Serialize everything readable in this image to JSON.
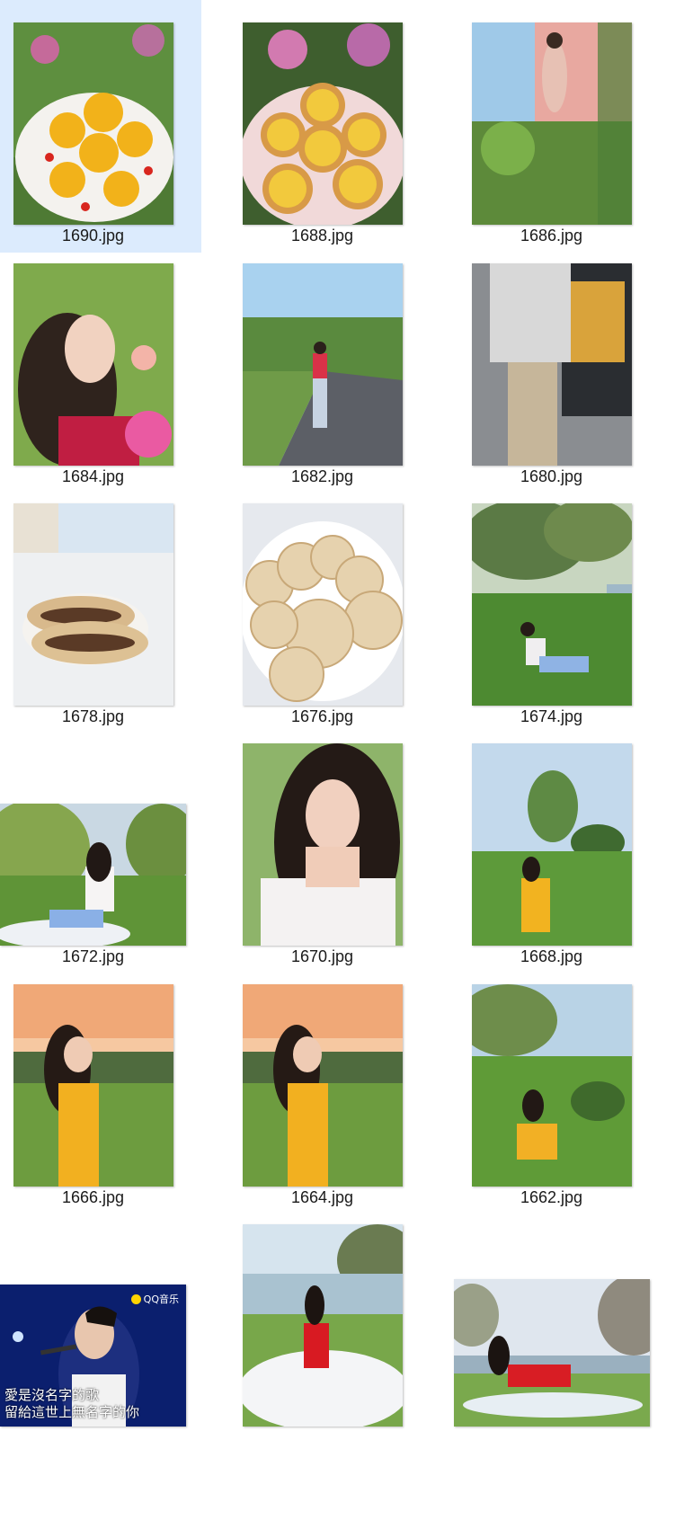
{
  "files": [
    {
      "name": "1690.jpg",
      "selected": true,
      "icon": "fruit-plate-photo"
    },
    {
      "name": "1688.jpg",
      "selected": false,
      "icon": "egg-tarts-photo"
    },
    {
      "name": "1686.jpg",
      "selected": false,
      "icon": "balcony-garden-photo"
    },
    {
      "name": "1684.jpg",
      "selected": false,
      "icon": "portrait-flowers-photo"
    },
    {
      "name": "1682.jpg",
      "selected": false,
      "icon": "road-pose-photo"
    },
    {
      "name": "1680.jpg",
      "selected": false,
      "icon": "car-trunk-photo"
    },
    {
      "name": "1678.jpg",
      "selected": false,
      "icon": "stuffed-pastry-photo"
    },
    {
      "name": "1676.jpg",
      "selected": false,
      "icon": "pancakes-photo"
    },
    {
      "name": "1674.jpg",
      "selected": false,
      "icon": "lakeside-grass-photo"
    },
    {
      "name": "1672.jpg",
      "selected": false,
      "icon": "picnic-willow-photo"
    },
    {
      "name": "1670.jpg",
      "selected": false,
      "icon": "selfie-photo"
    },
    {
      "name": "1668.jpg",
      "selected": false,
      "icon": "yellow-dress-field-photo"
    },
    {
      "name": "1666.jpg",
      "selected": false,
      "icon": "sunset-yellow-dress-photo"
    },
    {
      "name": "1664.jpg",
      "selected": false,
      "icon": "sunset-yellow-dress-photo"
    },
    {
      "name": "1662.jpg",
      "selected": false,
      "icon": "sitting-grass-photo"
    },
    {
      "name": "",
      "selected": false,
      "icon": "concert-screenshot-photo",
      "overlay": {
        "badge": "QQ音乐",
        "line1": "愛是沒名字的歌",
        "line2": "留給這世上無名字的你"
      }
    },
    {
      "name": "",
      "selected": false,
      "icon": "red-dress-picnic-photo"
    },
    {
      "name": "",
      "selected": false,
      "icon": "red-dress-lying-photo"
    }
  ],
  "colors": {
    "selection": "#dcebfd",
    "label": "#1a1a1a"
  }
}
